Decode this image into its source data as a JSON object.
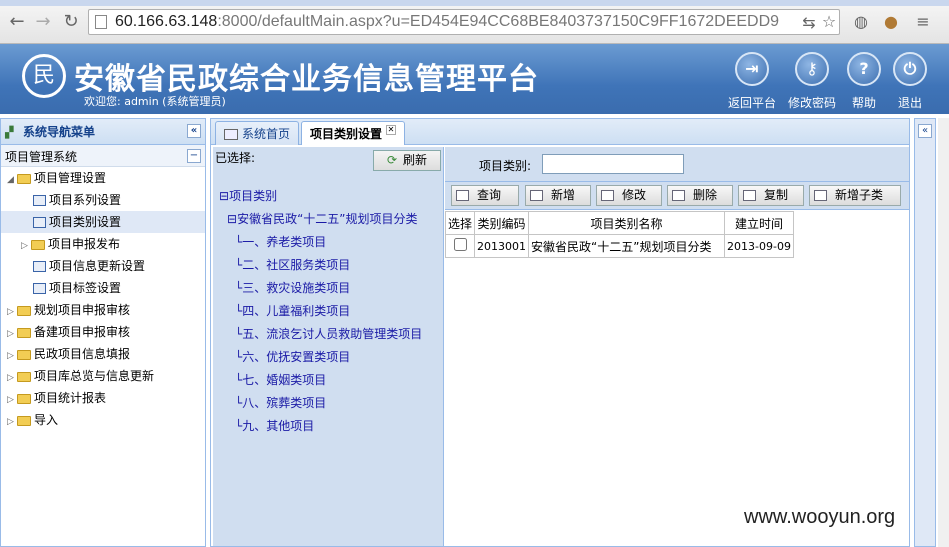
{
  "browser": {
    "url_host": "60.166.63.148",
    "url_rest": ":8000/defaultMain.aspx?u=ED454E94CC68BE8403737150C9FF1672DEEDD9"
  },
  "header": {
    "title": "安徽省民政综合业务信息管理平台",
    "welcome": "欢迎您: admin (系统管理员)",
    "buttons": [
      {
        "label": "返回平台",
        "icon": "return-icon"
      },
      {
        "label": "修改密码",
        "icon": "key-icon"
      },
      {
        "label": "帮助",
        "icon": "help-icon"
      },
      {
        "label": "退出",
        "icon": "power-icon"
      }
    ]
  },
  "sidebar": {
    "title": "系统导航菜单",
    "section": "项目管理系统",
    "items": [
      {
        "label": "项目管理设置"
      },
      {
        "label": "项目系列设置"
      },
      {
        "label": "项目类别设置"
      },
      {
        "label": "项目申报发布"
      },
      {
        "label": "项目信息更新设置"
      },
      {
        "label": "项目标签设置"
      },
      {
        "label": "规划项目申报审核"
      },
      {
        "label": "备建项目申报审核"
      },
      {
        "label": "民政项目信息填报"
      },
      {
        "label": "项目库总览与信息更新"
      },
      {
        "label": "项目统计报表"
      },
      {
        "label": "导入"
      }
    ]
  },
  "tabs": [
    {
      "label": "系统首页"
    },
    {
      "label": "项目类别设置"
    }
  ],
  "tree": {
    "selected_label": "已选择:",
    "refresh_label": "刷新",
    "root": "项目类别",
    "child": "安徽省民政“十二五”规划项目分类",
    "leaves": [
      "一、养老类项目",
      "二、社区服务类项目",
      "三、救灾设施类项目",
      "四、儿童福利类项目",
      "五、流浪乞讨人员救助管理类项目",
      "六、优抚安置类项目",
      "七、婚姻类项目",
      "八、殡葬类项目",
      "九、其他项目"
    ]
  },
  "filter": {
    "label": "项目类别:",
    "value": ""
  },
  "toolbar": [
    "查询",
    "新增",
    "修改",
    "删除",
    "复制",
    "新增子类"
  ],
  "grid": {
    "columns": [
      "选择",
      "类别编码",
      "项目类别名称",
      "建立时间"
    ],
    "rows": [
      [
        "",
        "2013001",
        "安徽省民政“十二五”规划项目分类",
        "2013-09-09"
      ]
    ]
  },
  "watermark": "www.wooyun.org"
}
